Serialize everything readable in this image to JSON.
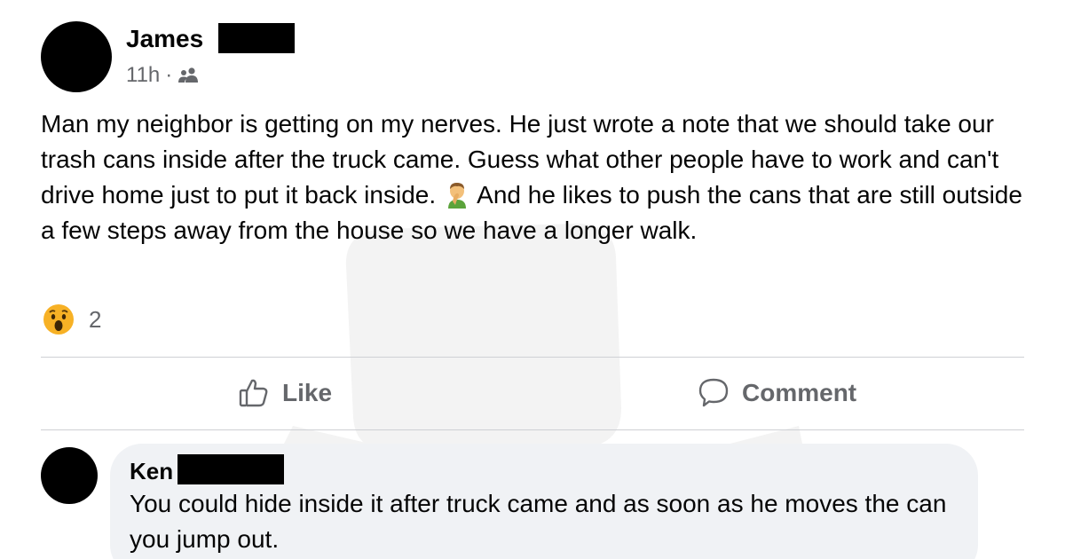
{
  "post": {
    "author_name": "James",
    "time": "11h",
    "separator": "·",
    "audience_icon": "friends-icon",
    "text_before_emoji": "Man my neighbor is getting on my nerves. He just wrote a note that we should take our trash cans inside after the truck came. Guess what other people have to work and can't drive home just to put it back inside.",
    "inline_emoji": "facepalm-emoji",
    "text_after_emoji": "And he likes to push the cans that are still outside a few steps away from the house so we have a longer walk."
  },
  "reactions": {
    "icon": "wow-reaction-icon",
    "count": "2"
  },
  "actions": {
    "like_label": "Like",
    "comment_label": "Comment"
  },
  "comment": {
    "author_name": "Ken",
    "text": "You could hide inside it after truck came and as soon as he moves the can you jump out."
  },
  "colors": {
    "secondary_text": "#65676b",
    "divider": "#ced0d4",
    "comment_bubble": "#f0f2f5",
    "wow_yellow": "#f7b125"
  }
}
